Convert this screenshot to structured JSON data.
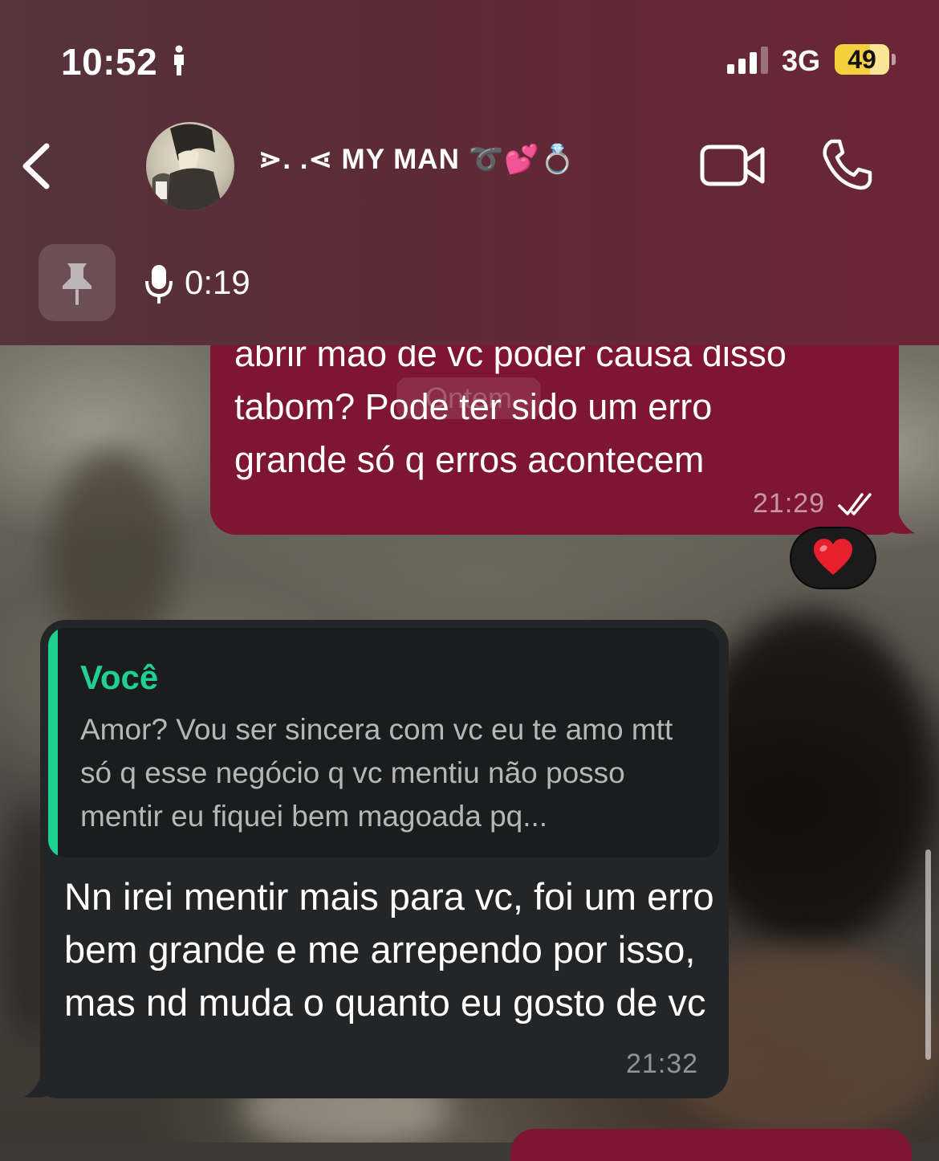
{
  "status_bar": {
    "time": "10:52",
    "network": "3G",
    "battery": "49",
    "battery_level_percent": 49,
    "icons": [
      "person-walking-icon",
      "signal-bars-icon",
      "battery-icon"
    ]
  },
  "header": {
    "contact_name": "⋗. .⋖ MY MAN ➰💕💍",
    "icons": [
      "back-arrow-icon",
      "avatar",
      "video-camera-icon",
      "phone-icon"
    ]
  },
  "pinned": {
    "icon": "pin-icon",
    "media_icon": "microphone-icon",
    "duration": "0:19"
  },
  "messages": [
    {
      "direction": "outgoing",
      "lines": [
        "abrir mão de vc poder causa disso",
        "tabom? Pode ter sido um erro",
        "grande só q erros acontecem"
      ],
      "time": "21:29",
      "status_icon": "double-check-icon",
      "reaction": "❤️",
      "overlay_pill": "Ontem"
    },
    {
      "direction": "incoming",
      "quote": {
        "author": "Você",
        "text": "Amor? Vou ser sincera com vc eu te amo mtt só q esse negócio q vc mentiu não posso mentir eu fiquei bem magoada pq..."
      },
      "text": "Nn irei mentir mais para vc, foi um erro bem grande e me arrependo por isso, mas nd muda o quanto eu gosto de vc",
      "time": "21:32"
    }
  ],
  "colors": {
    "header_bg": "#5e2a36",
    "outgoing_bubble": "#7e1633",
    "incoming_bubble": "#232526",
    "quote_accent": "#1ed193",
    "battery": "#f4d03f"
  }
}
